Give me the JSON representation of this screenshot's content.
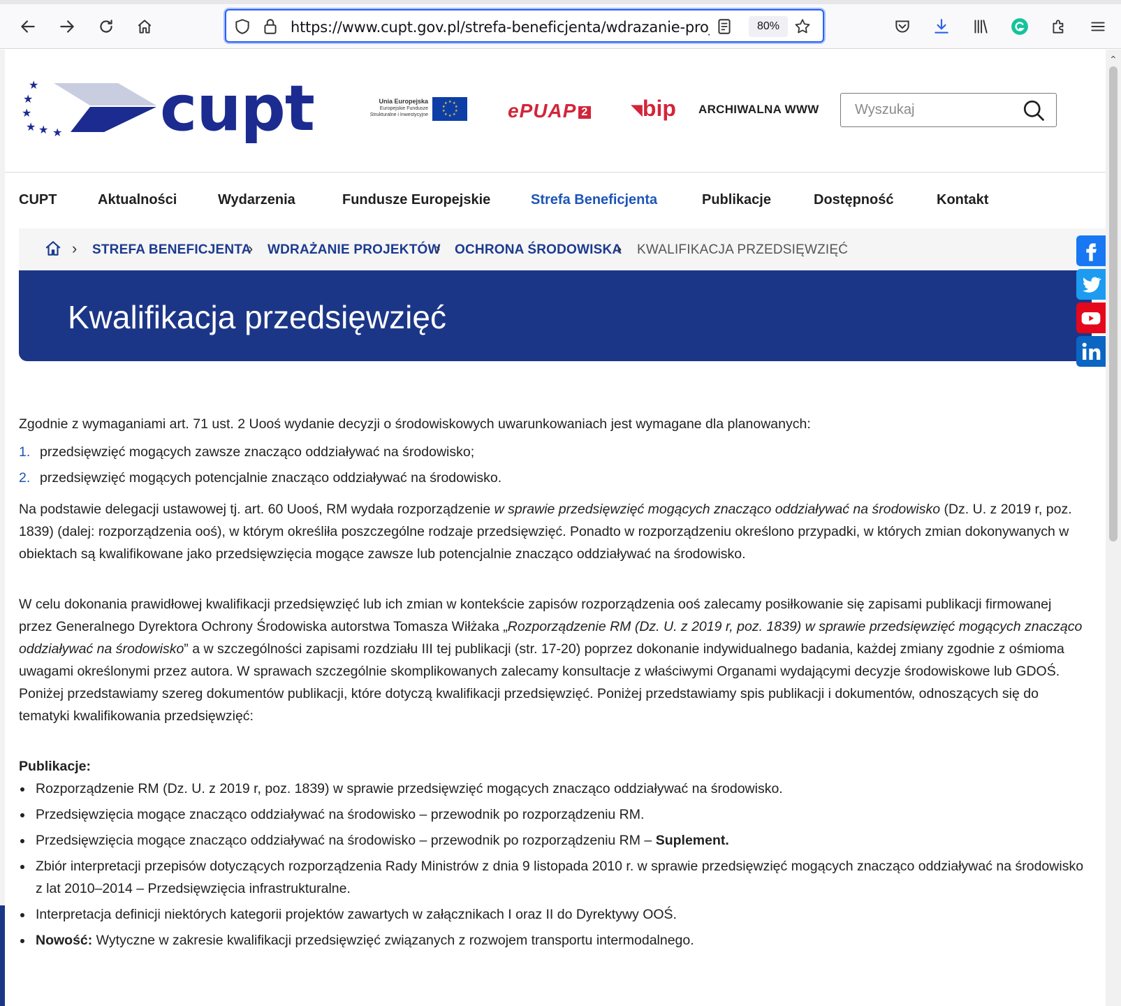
{
  "browser": {
    "url": "https://www.cupt.gov.pl/strefa-beneficjenta/wdrazanie-projekto",
    "zoom": "80%"
  },
  "header": {
    "logo_text": "cupt",
    "eu_title": "Unia Europejska",
    "eu_sub1": "Europejskie Fundusze",
    "eu_sub2": "Strukturalne i Inwestycyjne",
    "epuap_text": "ePUAP",
    "epuap_num": "2",
    "bip_text": "bip",
    "archive_link": "ARCHIWALNA WWW",
    "search_placeholder": "Wyszukaj"
  },
  "nav": {
    "items": [
      "CUPT",
      "Aktualności",
      "Wydarzenia",
      "Fundusze Europejskie",
      "Strefa Beneficjenta",
      "Publikacje",
      "Dostępność",
      "Kontakt"
    ],
    "active": "Strefa Beneficjenta"
  },
  "breadcrumb": {
    "items": [
      "STREFA BENEFICJENTA",
      "WDRAŻANIE PROJEKTÓW",
      "OCHRONA ŚRODOWISKA"
    ],
    "current": "KWALIFIKACJA PRZEDSIĘWZIĘĆ"
  },
  "page_title": "Kwalifikacja przedsięwzięć",
  "content": {
    "intro": "Zgodnie z wymaganiami art. 71 ust. 2 Uooś wydanie decyzji o środowiskowych uwarunkowaniach jest wymagane dla planowanych:",
    "list": [
      {
        "num": "1.",
        "text": "przedsięwzięć mogących zawsze znacząco oddziaływać na środowisko;"
      },
      {
        "num": "2.",
        "text": "przedsięwzięć mogących potencjalnie znacząco oddziaływać na środowisko."
      }
    ],
    "para2_a": "Na podstawie delegacji ustawowej tj. art. 60 Uooś, RM wydała rozporządzenie ",
    "para2_i": "w sprawie przedsięwzięć mogących znacząco oddziaływać na środowisko",
    "para2_b": " (Dz. U. z 2019 r, poz. 1839) (dalej: rozporządzenia ooś), w którym określiła poszczególne rodzaje przedsięwzięć. Ponadto w rozporządzeniu określono przypadki, w których zmian dokonywanych w obiektach są kwalifikowane jako przedsięwzięcia mogące zawsze lub potencjalnie znacząco oddziaływać na środowisko.",
    "para3_a": "W celu dokonania prawidłowej kwalifikacji przedsięwzięć lub ich zmian w kontekście zapisów rozporządzenia ooś zalecamy posiłkowanie się zapisami publikacji firmowanej przez Generalnego Dyrektora Ochrony Środowiska autorstwa Tomasza Wiłżaka „",
    "para3_i": "Rozporządzenie RM (Dz. U. z 2019 r, poz. 1839) w sprawie przedsięwzięć mogących znacząco oddziaływać na środowisko",
    "para3_b": "” a w szczególności zapisami rozdziału III tej publikacji (str. 17-20) poprzez dokonanie indywidualnego badania, każdej zmiany zgodnie z ośmioma uwagami określonymi przez autora. W sprawach szczególnie skomplikowanych zalecamy konsultacje z właściwymi Organami wydającymi decyzje środowiskowe lub GDOŚ. Poniżej przedstawiamy szereg dokumentów publikacji, które dotyczą kwalifikacji przedsięwzięć. Poniżej przedstawiamy spis publikacji i dokumentów, odnoszących się do tematyki kwalifikowania przedsięwzięć:",
    "publications_heading": "Publikacje:",
    "pub1": "Rozporządzenie RM (Dz. U. z 2019 r, poz. 1839) w sprawie przedsięwzięć mogących znacząco oddziaływać na środowisko.",
    "pub2": "Przedsięwzięcia mogące znacząco oddziaływać na środowisko – przewodnik po rozporządzeniu RM.",
    "pub3_a": "Przedsięwzięcia mogące znacząco oddziaływać na środowisko – przewodnik po rozporządzeniu RM – ",
    "pub3_b": "Suplement",
    "pub3_c": ".",
    "pub4": "Zbiór interpretacji przepisów dotyczących rozporządzenia Rady Ministrów z dnia 9 listopada 2010 r. w sprawie przedsięwzięć mogących znacząco oddziaływać na środowisko z lat 2010–2014 – Przedsięwzięcia infrastrukturalne.",
    "pub5": "Interpretacja definicji niektórych kategorii projektów zawartych w załącznikach I oraz II do Dyrektywy OOŚ.",
    "pub6_a": "Nowość:",
    "pub6_b": " Wytyczne w zakresie kwalifikacji przedsięwzięć związanych z rozwojem transportu intermodalnego."
  },
  "colors": {
    "brand_blue": "#1c3687",
    "link_blue": "#1d55b8",
    "facebook": "#1877f2",
    "twitter": "#1d9bf0",
    "youtube": "#e5071b",
    "linkedin": "#0a66c2"
  }
}
